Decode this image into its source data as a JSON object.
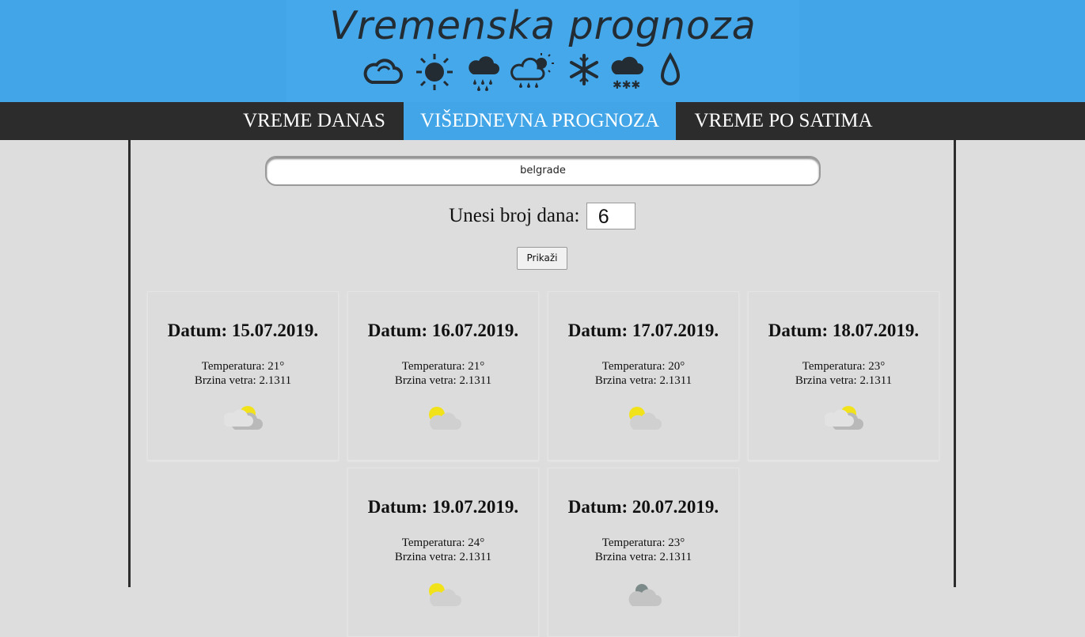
{
  "header": {
    "title": "Vremenska prognoza",
    "icons": [
      "cloud-icon",
      "sun-icon",
      "rain-cloud-icon",
      "sun-cloud-rain-icon",
      "snowflake-icon",
      "snow-cloud-icon",
      "drop-icon"
    ]
  },
  "nav": {
    "items": [
      {
        "label": "VREME DANAS",
        "active": false
      },
      {
        "label": "VIŠEDNEVNA PROGNOZA",
        "active": true
      },
      {
        "label": "VREME PO SATIMA",
        "active": false
      }
    ]
  },
  "form": {
    "city_value": "belgrade",
    "days_label": "Unesi broj dana:",
    "days_value": "6",
    "button_label": "Prikaži"
  },
  "forecast": [
    {
      "date": "Datum: 15.07.2019.",
      "temp": "Temperatura: 21°",
      "wind": "Brzina vetra: 2.1311",
      "icon": "sun-behind-gray-cloud-icon"
    },
    {
      "date": "Datum: 16.07.2019.",
      "temp": "Temperatura: 21°",
      "wind": "Brzina vetra: 2.1311",
      "icon": "partly-cloudy-icon"
    },
    {
      "date": "Datum: 17.07.2019.",
      "temp": "Temperatura: 20°",
      "wind": "Brzina vetra: 2.1311",
      "icon": "partly-cloudy-icon"
    },
    {
      "date": "Datum: 18.07.2019.",
      "temp": "Temperatura: 23°",
      "wind": "Brzina vetra: 2.1311",
      "icon": "sun-behind-gray-cloud-icon"
    },
    {
      "date": "Datum: 19.07.2019.",
      "temp": "Temperatura: 24°",
      "wind": "Brzina vetra: 2.1311",
      "icon": "partly-cloudy-icon"
    },
    {
      "date": "Datum: 20.07.2019.",
      "temp": "Temperatura: 23°",
      "wind": "Brzina vetra: 2.1311",
      "icon": "cloudy-icon"
    }
  ],
  "colors": {
    "header_blue": "#41a5e8",
    "nav_dark": "#2c2c2c",
    "page_bg": "#dddddd",
    "sun_yellow": "#f2e21a"
  }
}
